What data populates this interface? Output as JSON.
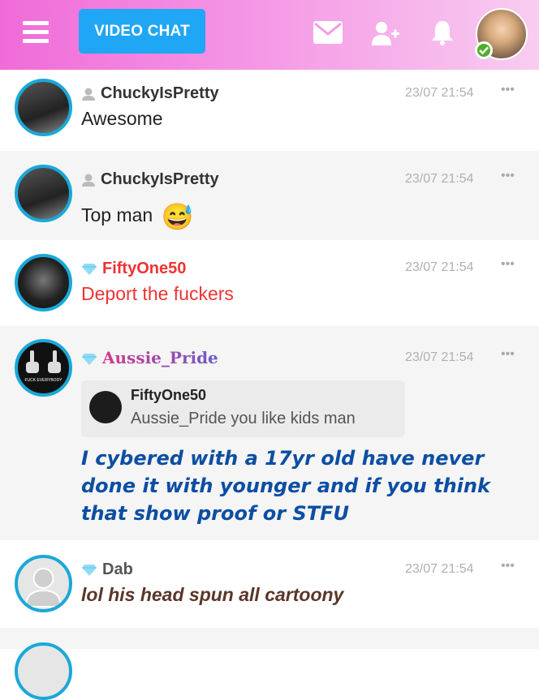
{
  "header": {
    "video_chat_label": "VIDEO CHAT",
    "icons": [
      "menu-icon",
      "mail-icon",
      "add-user-icon",
      "bell-icon"
    ],
    "accent": "#1fa6f5",
    "online_color": "#4caf2a"
  },
  "messages": [
    {
      "user": "ChuckyIsPretty",
      "rank": "user-icon",
      "time": "23/07 21:54",
      "text": "Awesome"
    },
    {
      "user": "ChuckyIsPretty",
      "rank": "user-icon",
      "time": "23/07 21:54",
      "text": "Top man",
      "emoji": "😅"
    },
    {
      "user": "FiftyOne50",
      "rank": "diamond-icon",
      "time": "23/07 21:54",
      "text": "Deport the fuckers",
      "color": "#ee3333"
    },
    {
      "user": "Aussie_Pride",
      "rank": "diamond-icon",
      "time": "23/07 21:54",
      "avatar_caption": "FUCK EVERYBODY",
      "quote": {
        "user": "FiftyOne50",
        "text": "Aussie_Pride you like kids man"
      },
      "text": "I cybered with a 17yr old have never done it with younger and if you think that show proof or STFU",
      "color": "#0c4ea3"
    },
    {
      "user": "Dab",
      "rank": "diamond-icon",
      "time": "23/07 21:54",
      "text": "lol his head spun all cartoony",
      "color": "#5a3628"
    }
  ],
  "more_label": "•••"
}
